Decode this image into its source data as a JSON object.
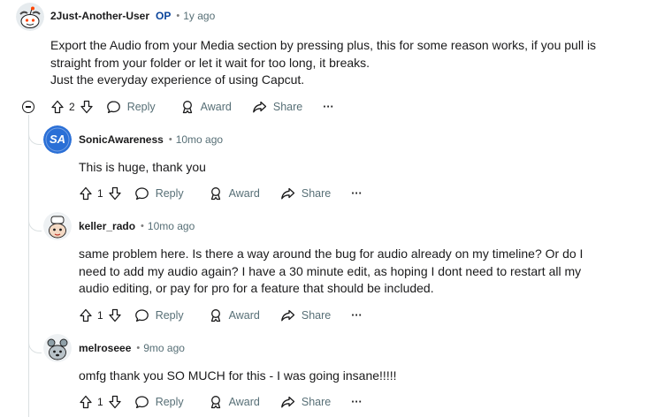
{
  "comments": [
    {
      "username": "2Just-Another-User",
      "op_badge": "OP",
      "time": "1y ago",
      "lines": [
        "Export the Audio from your Media section by pressing plus, this for some reason works, if you pull is",
        "straight from your folder or let it wait for too long, it breaks.",
        "Just the everyday experience of using Capcut."
      ],
      "votes": "2",
      "reply": "Reply",
      "award": "Award",
      "share": "Share",
      "more": "···"
    },
    {
      "username": "SonicAwareness",
      "time": "10mo ago",
      "lines": [
        "This is huge, thank you"
      ],
      "votes": "1",
      "reply": "Reply",
      "award": "Award",
      "share": "Share",
      "more": "···"
    },
    {
      "username": "keller_rado",
      "time": "10mo ago",
      "lines": [
        "same problem here. Is there a way around the bug for audio already on my timeline? Or do I",
        "need to add my audio again? I have a 30 minute edit, as hoping I dont need to restart all my",
        "audio editing, or pay for pro for a feature that should be included."
      ],
      "votes": "1",
      "reply": "Reply",
      "award": "Award",
      "share": "Share",
      "more": "···"
    },
    {
      "username": "melroseee",
      "time": "9mo ago",
      "lines": [
        "omfg thank you SO MUCH for this - I was going insane!!!!!"
      ],
      "votes": "1",
      "reply": "Reply",
      "award": "Award",
      "share": "Share",
      "more": "···"
    }
  ],
  "avatars": {
    "sonic_initials": "SA"
  },
  "colors": {
    "op": "#0a449b",
    "meta": "#576f76",
    "thread_line": "#dbe0e2",
    "sonic_avatar": "#2a6fd6"
  }
}
